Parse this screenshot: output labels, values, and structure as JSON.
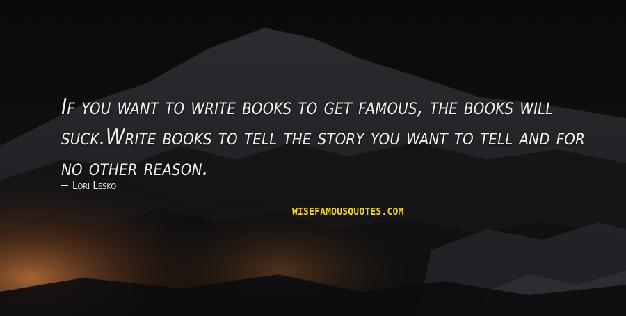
{
  "quote": {
    "text": "If you want to write books to get famous, the books will suck.Write books to tell the story you want to tell and for no other reason."
  },
  "author": {
    "name": "Lori Lesko"
  },
  "watermark": {
    "text": "WISEFAMOUSQUOTES.COM"
  },
  "colors": {
    "background": "#0b0b0d",
    "text": "#f2f2f2",
    "watermark": "#f4d61a",
    "glow": "#c0733a"
  }
}
